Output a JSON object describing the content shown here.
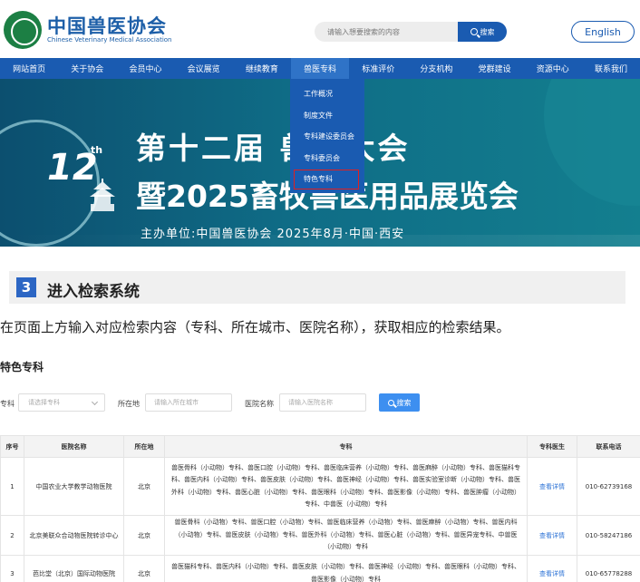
{
  "header": {
    "logo_cn": "中国兽医协会",
    "logo_en": "Chinese Veterinary Medical Association",
    "search_placeholder": "请输入想要搜索的内容",
    "search_button": "搜索",
    "english_button": "English"
  },
  "nav": {
    "items": [
      {
        "label": "网站首页"
      },
      {
        "label": "关于协会"
      },
      {
        "label": "会员中心"
      },
      {
        "label": "会议展览"
      },
      {
        "label": "继续教育"
      },
      {
        "label": "兽医专科"
      },
      {
        "label": "标准评价"
      },
      {
        "label": "分支机构"
      },
      {
        "label": "党群建设"
      },
      {
        "label": "资源中心"
      },
      {
        "label": "联系我们"
      }
    ],
    "active_index": 5
  },
  "dropdown": {
    "items": [
      {
        "label": "工作概况"
      },
      {
        "label": "制度文件"
      },
      {
        "label": "专科建设委员会"
      },
      {
        "label": "专科委员会"
      },
      {
        "label": "特色专科"
      }
    ],
    "highlight_index": 4
  },
  "banner": {
    "number": "12",
    "suffix": "th",
    "line1": "第十二届 兽医大会",
    "line2": "暨2025畜牧兽医用品展览会",
    "line3": "主办单位:中国兽医协会   2025年8月·中国·西安"
  },
  "section": {
    "number": "3",
    "title": "进入检索系统",
    "description": "在页面上方输入对应检索内容（专科、所在城市、医院名称），获取相应的检索结果。"
  },
  "page_title": "特色专科",
  "filters": {
    "specialty_label": "专科",
    "specialty_placeholder": "请选择专科",
    "city_label": "所在地",
    "city_placeholder": "请输入所在城市",
    "hospital_label": "医院名称",
    "hospital_placeholder": "请输入医院名称",
    "search_button": "搜索"
  },
  "table": {
    "headers": [
      "序号",
      "医院名称",
      "所在地",
      "专科",
      "专科医生",
      "联系电话"
    ],
    "rows": [
      {
        "index": "1",
        "hospital": "中国农业大学教学动物医院",
        "city": "北京",
        "specialties": "兽医骨科（小动物）专科、兽医口腔（小动物）专科、兽医临床营养（小动物）专科、兽医麻醉（小动物）专科、兽医猫科专科、兽医内科（小动物）专科、兽医皮肤（小动物）专科、兽医神经（小动物）专科、兽医实验室诊断（小动物）专科、兽医外科（小动物）专科、兽医心脏（小动物）专科、兽医眼科（小动物）专科、兽医影像（小动物）专科、兽医肿瘤（小动物）专科、中兽医（小动物）专科",
        "doctor": "查看详情",
        "phone": "010-62739168"
      },
      {
        "index": "2",
        "hospital": "北京美联众合动物医院转诊中心",
        "city": "北京",
        "specialties": "兽医骨科（小动物）专科、兽医口腔（小动物）专科、兽医临床营养（小动物）专科、兽医麻醉（小动物）专科、兽医内科（小动物）专科、兽医皮肤（小动物）专科、兽医外科（小动物）专科、兽医心脏（小动物）专科、兽医异宠专科、中兽医（小动物）专科",
        "doctor": "查看详情",
        "phone": "010-58247186"
      },
      {
        "index": "3",
        "hospital": "芭比堂（北京）国际动物医院",
        "city": "北京",
        "specialties": "兽医猫科专科、兽医内科（小动物）专科、兽医皮肤（小动物）专科、兽医神经（小动物）专科、兽医眼科（小动物）专科、兽医影像（小动物）专科",
        "doctor": "查看详情",
        "phone": "010-65778288"
      }
    ]
  },
  "colors": {
    "brand_blue": "#1a5bb1",
    "logo_green": "#1c7f44",
    "link_blue": "#2d73d6",
    "highlight_red": "#e02020"
  }
}
